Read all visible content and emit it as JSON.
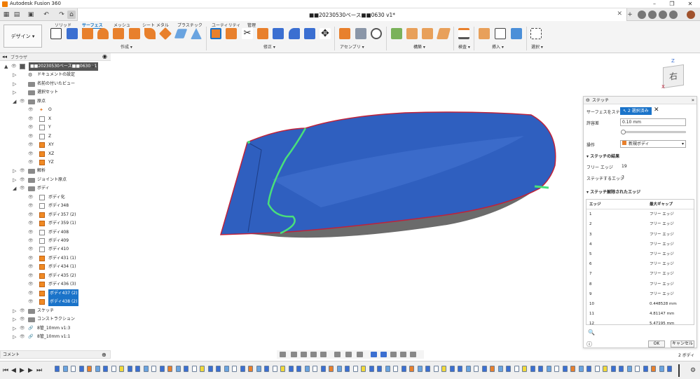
{
  "app": {
    "title": "Autodesk Fusion 360",
    "document_title": "■■20230530ベース■■0630 v1*",
    "window_controls": [
      "–",
      "❐",
      "✕"
    ]
  },
  "ribbon": {
    "workspace": "デザイン ▾",
    "tabs": [
      "ソリッド",
      "サーフェス",
      "メッシュ",
      "シート メタル",
      "プラスチック",
      "ユーティリティ",
      "管理"
    ],
    "active_tab": "サーフェス",
    "groups": [
      "作成 ▾",
      "修正 ▾",
      "アセンブリ ▾",
      "構築 ▾",
      "検査 ▾",
      "挿入 ▾",
      "選択 ▾"
    ]
  },
  "browser": {
    "title": "ブラウザ",
    "rows": [
      {
        "label": "■■20230530ベース■■0630 v1",
        "level": 0,
        "twist": "▲",
        "icon": "doc",
        "selected": false,
        "root": true
      },
      {
        "label": "ドキュメントの設定",
        "level": 1,
        "twist": "▷",
        "icon": "gear",
        "selected": false
      },
      {
        "label": "名前の付いたビュー",
        "level": 1,
        "twist": "▷",
        "icon": "folder",
        "selected": false
      },
      {
        "label": "選択セット",
        "level": 1,
        "twist": "▷",
        "icon": "folder",
        "selected": false
      },
      {
        "label": "原点",
        "level": 1,
        "twist": "◢",
        "icon": "folder",
        "selected": false,
        "eye": true
      },
      {
        "label": "O",
        "level": 2,
        "twist": "",
        "icon": "origin",
        "selected": false,
        "eye": true
      },
      {
        "label": "X",
        "level": 2,
        "twist": "",
        "icon": "box",
        "selected": false,
        "eye": true
      },
      {
        "label": "Y",
        "level": 2,
        "twist": "",
        "icon": "box",
        "selected": false,
        "eye": true
      },
      {
        "label": "Z",
        "level": 2,
        "twist": "",
        "icon": "box",
        "selected": false,
        "eye": true
      },
      {
        "label": "XY",
        "level": 2,
        "twist": "",
        "icon": "orange",
        "selected": false,
        "eye": true
      },
      {
        "label": "XZ",
        "level": 2,
        "twist": "",
        "icon": "orange",
        "selected": false,
        "eye": true
      },
      {
        "label": "YZ",
        "level": 2,
        "twist": "",
        "icon": "orange",
        "selected": false,
        "eye": true
      },
      {
        "label": "解析",
        "level": 1,
        "twist": "▷",
        "icon": "folder",
        "selected": false,
        "eye": true
      },
      {
        "label": "ジョイント原点",
        "level": 1,
        "twist": "▷",
        "icon": "folder",
        "selected": false,
        "eye": true
      },
      {
        "label": "ボディ",
        "level": 1,
        "twist": "◢",
        "icon": "folder",
        "selected": false,
        "eye": true
      },
      {
        "label": "ボディ化",
        "level": 2,
        "twist": "",
        "icon": "box",
        "selected": false,
        "eye": true
      },
      {
        "label": "ボディ348",
        "level": 2,
        "twist": "",
        "icon": "box",
        "selected": false,
        "eye": true
      },
      {
        "label": "ボディ357 (2)",
        "level": 2,
        "twist": "",
        "icon": "orange",
        "selected": false,
        "eye": true
      },
      {
        "label": "ボディ359 (1)",
        "level": 2,
        "twist": "",
        "icon": "orange",
        "selected": false,
        "eye": true
      },
      {
        "label": "ボディ408",
        "level": 2,
        "twist": "",
        "icon": "box",
        "selected": false,
        "eye": true
      },
      {
        "label": "ボディ409",
        "level": 2,
        "twist": "",
        "icon": "box",
        "selected": false,
        "eye": true
      },
      {
        "label": "ボディ410",
        "level": 2,
        "twist": "",
        "icon": "box",
        "selected": false,
        "eye": true
      },
      {
        "label": "ボディ431 (1)",
        "level": 2,
        "twist": "",
        "icon": "orange",
        "selected": false,
        "eye": true
      },
      {
        "label": "ボディ434 (1)",
        "level": 2,
        "twist": "",
        "icon": "orange",
        "selected": false,
        "eye": true
      },
      {
        "label": "ボディ435 (2)",
        "level": 2,
        "twist": "",
        "icon": "orange",
        "selected": false,
        "eye": true
      },
      {
        "label": "ボディ436 (3)",
        "level": 2,
        "twist": "",
        "icon": "orange",
        "selected": false,
        "eye": true
      },
      {
        "label": "ボディ437 (2)",
        "level": 2,
        "twist": "",
        "icon": "orange",
        "selected": true,
        "eye": true
      },
      {
        "label": "ボディ438 (2)",
        "level": 2,
        "twist": "",
        "icon": "orange",
        "selected": true,
        "eye": true
      },
      {
        "label": "スケッチ",
        "level": 1,
        "twist": "▷",
        "icon": "folder",
        "selected": false,
        "eye": true
      },
      {
        "label": "コンストラクション",
        "level": 1,
        "twist": "▷",
        "icon": "folder",
        "selected": false,
        "eye": true
      },
      {
        "label": "8管_10mm v1:3",
        "level": 1,
        "twist": "▷",
        "icon": "link",
        "selected": false,
        "eye": true
      },
      {
        "label": "8管_10mm v1:1",
        "level": 1,
        "twist": "▷",
        "icon": "link",
        "selected": false,
        "eye": true
      }
    ]
  },
  "comments": {
    "label": "コメント"
  },
  "viewcube": {
    "face": "右",
    "axis_z": "Z",
    "axis_x": "X"
  },
  "stitch_panel": {
    "title": "ステッチ",
    "surface_label": "サーフェスをステッチ",
    "selection_value": "2 選択済み",
    "tolerance_label": "許容差",
    "tolerance_value": "0.10 mm",
    "operation_label": "操作",
    "operation_value": "新規ボディ",
    "result_header": "ステッチの結果",
    "free_edge_label": "フリー エッジ",
    "free_edge_count": "19",
    "stitched_edge_label": "ステッチするエッジ",
    "stitched_edge_count": "7",
    "unstitched_header": "ステッチ解除されたエッジ",
    "col_edge": "エッジ",
    "col_gap": "最大ギャップ",
    "edges": [
      {
        "id": "1",
        "gap": "フリー エッジ"
      },
      {
        "id": "2",
        "gap": "フリー エッジ"
      },
      {
        "id": "3",
        "gap": "フリー エッジ"
      },
      {
        "id": "4",
        "gap": "フリー エッジ"
      },
      {
        "id": "5",
        "gap": "フリー エッジ"
      },
      {
        "id": "6",
        "gap": "フリー エッジ"
      },
      {
        "id": "7",
        "gap": "フリー エッジ"
      },
      {
        "id": "8",
        "gap": "フリー エッジ"
      },
      {
        "id": "9",
        "gap": "フリー エッジ"
      },
      {
        "id": "10",
        "gap": "0.448528 mm"
      },
      {
        "id": "11",
        "gap": "4.81147 mm"
      },
      {
        "id": "12",
        "gap": "5.47195 mm"
      }
    ],
    "ok": "OK",
    "cancel": "キャンセル"
  },
  "status": {
    "body_count": "2 ボディ"
  },
  "colors": {
    "accent": "#1a73c9",
    "surface": "#2f5fbf",
    "stitch_green": "#49e07a",
    "edge_red": "#c0223a"
  }
}
